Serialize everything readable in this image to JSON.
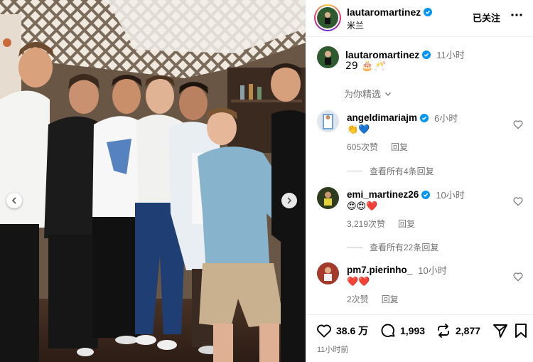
{
  "header": {
    "username": "lautaromartinez",
    "location": "米兰",
    "follow_label": "已关注",
    "more_icon": "more-horizontal-icon"
  },
  "caption": {
    "username": "lautaromartinez",
    "time": "11小时",
    "text": "29 🎂🥂",
    "translate_label": "为你精选"
  },
  "comments": [
    {
      "username": "angeldimariajm",
      "time": "6小时",
      "text": "👏💙",
      "likes": "605次赞",
      "reply_label": "回复",
      "view_replies": "查看所有4条回复"
    },
    {
      "username": "emi_martinez26",
      "time": "10小时",
      "text": "😍😍❤️",
      "likes": "3,219次赞",
      "reply_label": "回复",
      "view_replies": "查看所有22条回复"
    },
    {
      "username": "pm7.pierinho_",
      "time": "10小时",
      "text": "❤️❤️",
      "likes": "2次赞",
      "reply_label": "回复"
    }
  ],
  "actions": {
    "likes": "38.6 万",
    "comments": "1,993",
    "reposts": "2,877",
    "posted_time": "11小时前"
  },
  "colors": {
    "verified": "#0095f6",
    "secondary_text": "#737373",
    "divider": "#efefef"
  }
}
